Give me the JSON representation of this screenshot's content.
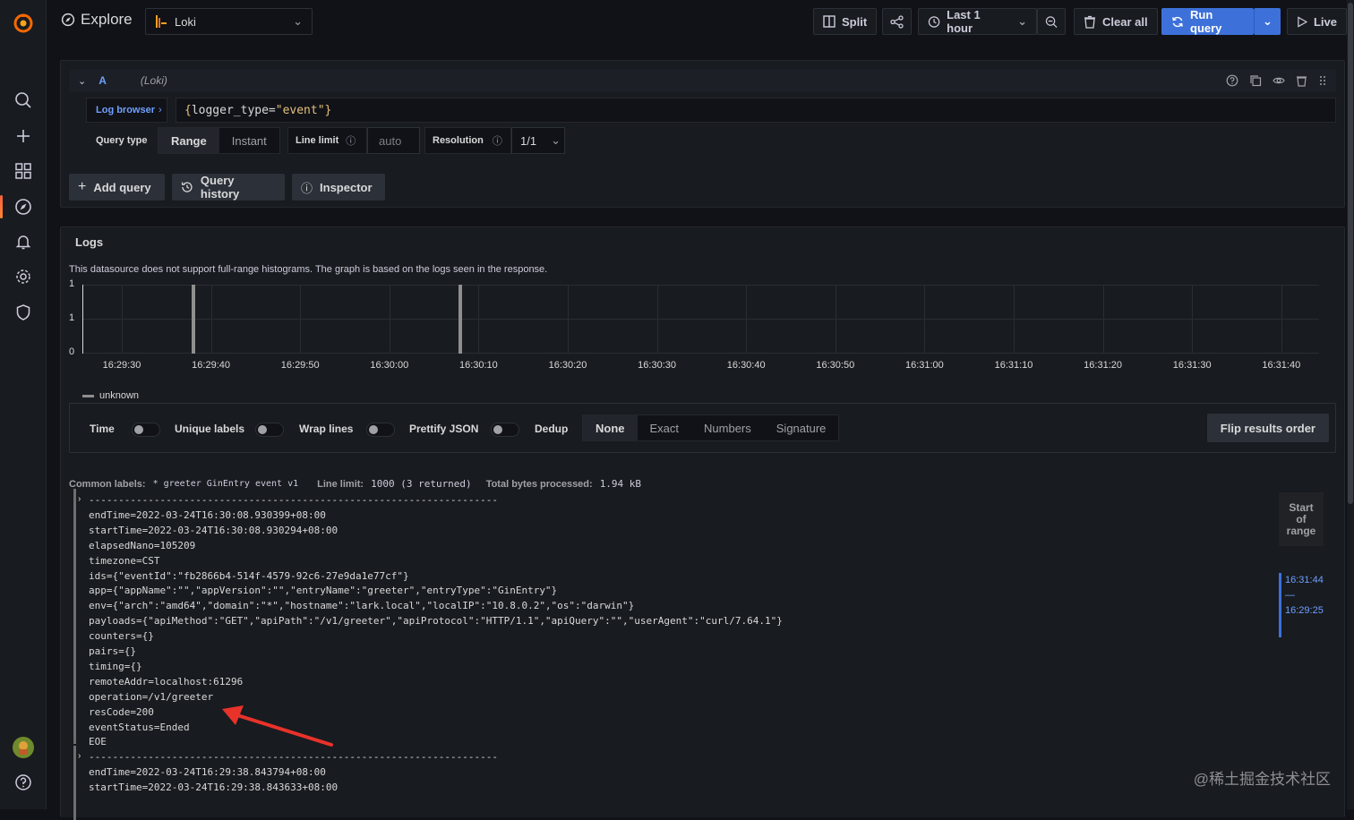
{
  "header": {
    "title": "Explore",
    "datasource": "Loki",
    "split_label": "Split",
    "time_range": "Last 1 hour",
    "clear_label": "Clear all",
    "run_label": "Run query",
    "live_label": "Live"
  },
  "query": {
    "ref_id": "A",
    "datasource_hint": "(Loki)",
    "log_browser_label": "Log browser",
    "expr_open": "{",
    "expr_key": "logger_type",
    "expr_eq": "=",
    "expr_val": "\"event\"",
    "expr_close": "}",
    "query_type_label": "Query type",
    "query_type_options": [
      "Range",
      "Instant"
    ],
    "line_limit_label": "Line limit",
    "line_limit_placeholder": "auto",
    "resolution_label": "Resolution",
    "resolution_value": "1/1",
    "add_query_label": "Add query",
    "history_label": "Query history",
    "inspector_label": "Inspector"
  },
  "logs": {
    "title": "Logs",
    "notice": "This datasource does not support full-range histograms. The graph is based on the logs seen in the response.",
    "legend": "unknown",
    "options": {
      "time_label": "Time",
      "unique_labels_label": "Unique labels",
      "wrap_lines_label": "Wrap lines",
      "prettify_label": "Prettify JSON",
      "dedup_label": "Dedup",
      "dedup_options": [
        "None",
        "Exact",
        "Numbers",
        "Signature"
      ],
      "flip_label": "Flip results order"
    },
    "meta": {
      "common_labels_label": "Common labels:",
      "common_labels_value": "* greeter GinEntry event v1",
      "line_limit_label": "Line limit:",
      "line_limit_value": "1000 (3 returned)",
      "bytes_label": "Total bytes processed:",
      "bytes_value": "1.94 kB"
    },
    "lines": [
      "---------------------------------------------------------------------",
      "endTime=2022-03-24T16:30:08.930399+08:00",
      "startTime=2022-03-24T16:30:08.930294+08:00",
      "elapsedNano=105209",
      "timezone=CST",
      "ids={\"eventId\":\"fb2866b4-514f-4579-92c6-27e9da1e77cf\"}",
      "app={\"appName\":\"\",\"appVersion\":\"\",\"entryName\":\"greeter\",\"entryType\":\"GinEntry\"}",
      "env={\"arch\":\"amd64\",\"domain\":\"*\",\"hostname\":\"lark.local\",\"localIP\":\"10.8.0.2\",\"os\":\"darwin\"}",
      "payloads={\"apiMethod\":\"GET\",\"apiPath\":\"/v1/greeter\",\"apiProtocol\":\"HTTP/1.1\",\"apiQuery\":\"\",\"userAgent\":\"curl/7.64.1\"}",
      "counters={}",
      "pairs={}",
      "timing={}",
      "remoteAddr=localhost:61296",
      "operation=/v1/greeter",
      "resCode=200",
      "eventStatus=Ended",
      "EOE",
      "---------------------------------------------------------------------",
      "endTime=2022-03-24T16:29:38.843794+08:00",
      "startTime=2022-03-24T16:29:38.843633+08:00"
    ],
    "range": {
      "label_1": "Start",
      "label_2": "of",
      "label_3": "range",
      "end": "16:31:44",
      "dash": "—",
      "start": "16:29:25"
    }
  },
  "chart_data": {
    "type": "bar",
    "x_ticks": [
      "16:29:30",
      "16:29:40",
      "16:29:50",
      "16:30:00",
      "16:30:10",
      "16:30:20",
      "16:30:30",
      "16:30:40",
      "16:30:50",
      "16:31:00",
      "16:31:10",
      "16:31:20",
      "16:31:30",
      "16:31:40"
    ],
    "y_ticks": [
      "1",
      "1",
      "0"
    ],
    "series": [
      {
        "name": "unknown",
        "x": [
          "16:29:25",
          "16:29:38",
          "16:30:08"
        ],
        "values": [
          1,
          1,
          1
        ]
      }
    ],
    "ylim": [
      0,
      1
    ],
    "grid": true,
    "legend": "bottom-left"
  },
  "watermark": "@稀土掘金技术社区",
  "colors": {
    "accent": "#3d71d9",
    "background": "#111217",
    "panel": "#181b1f",
    "arrow": "#e8322a"
  }
}
